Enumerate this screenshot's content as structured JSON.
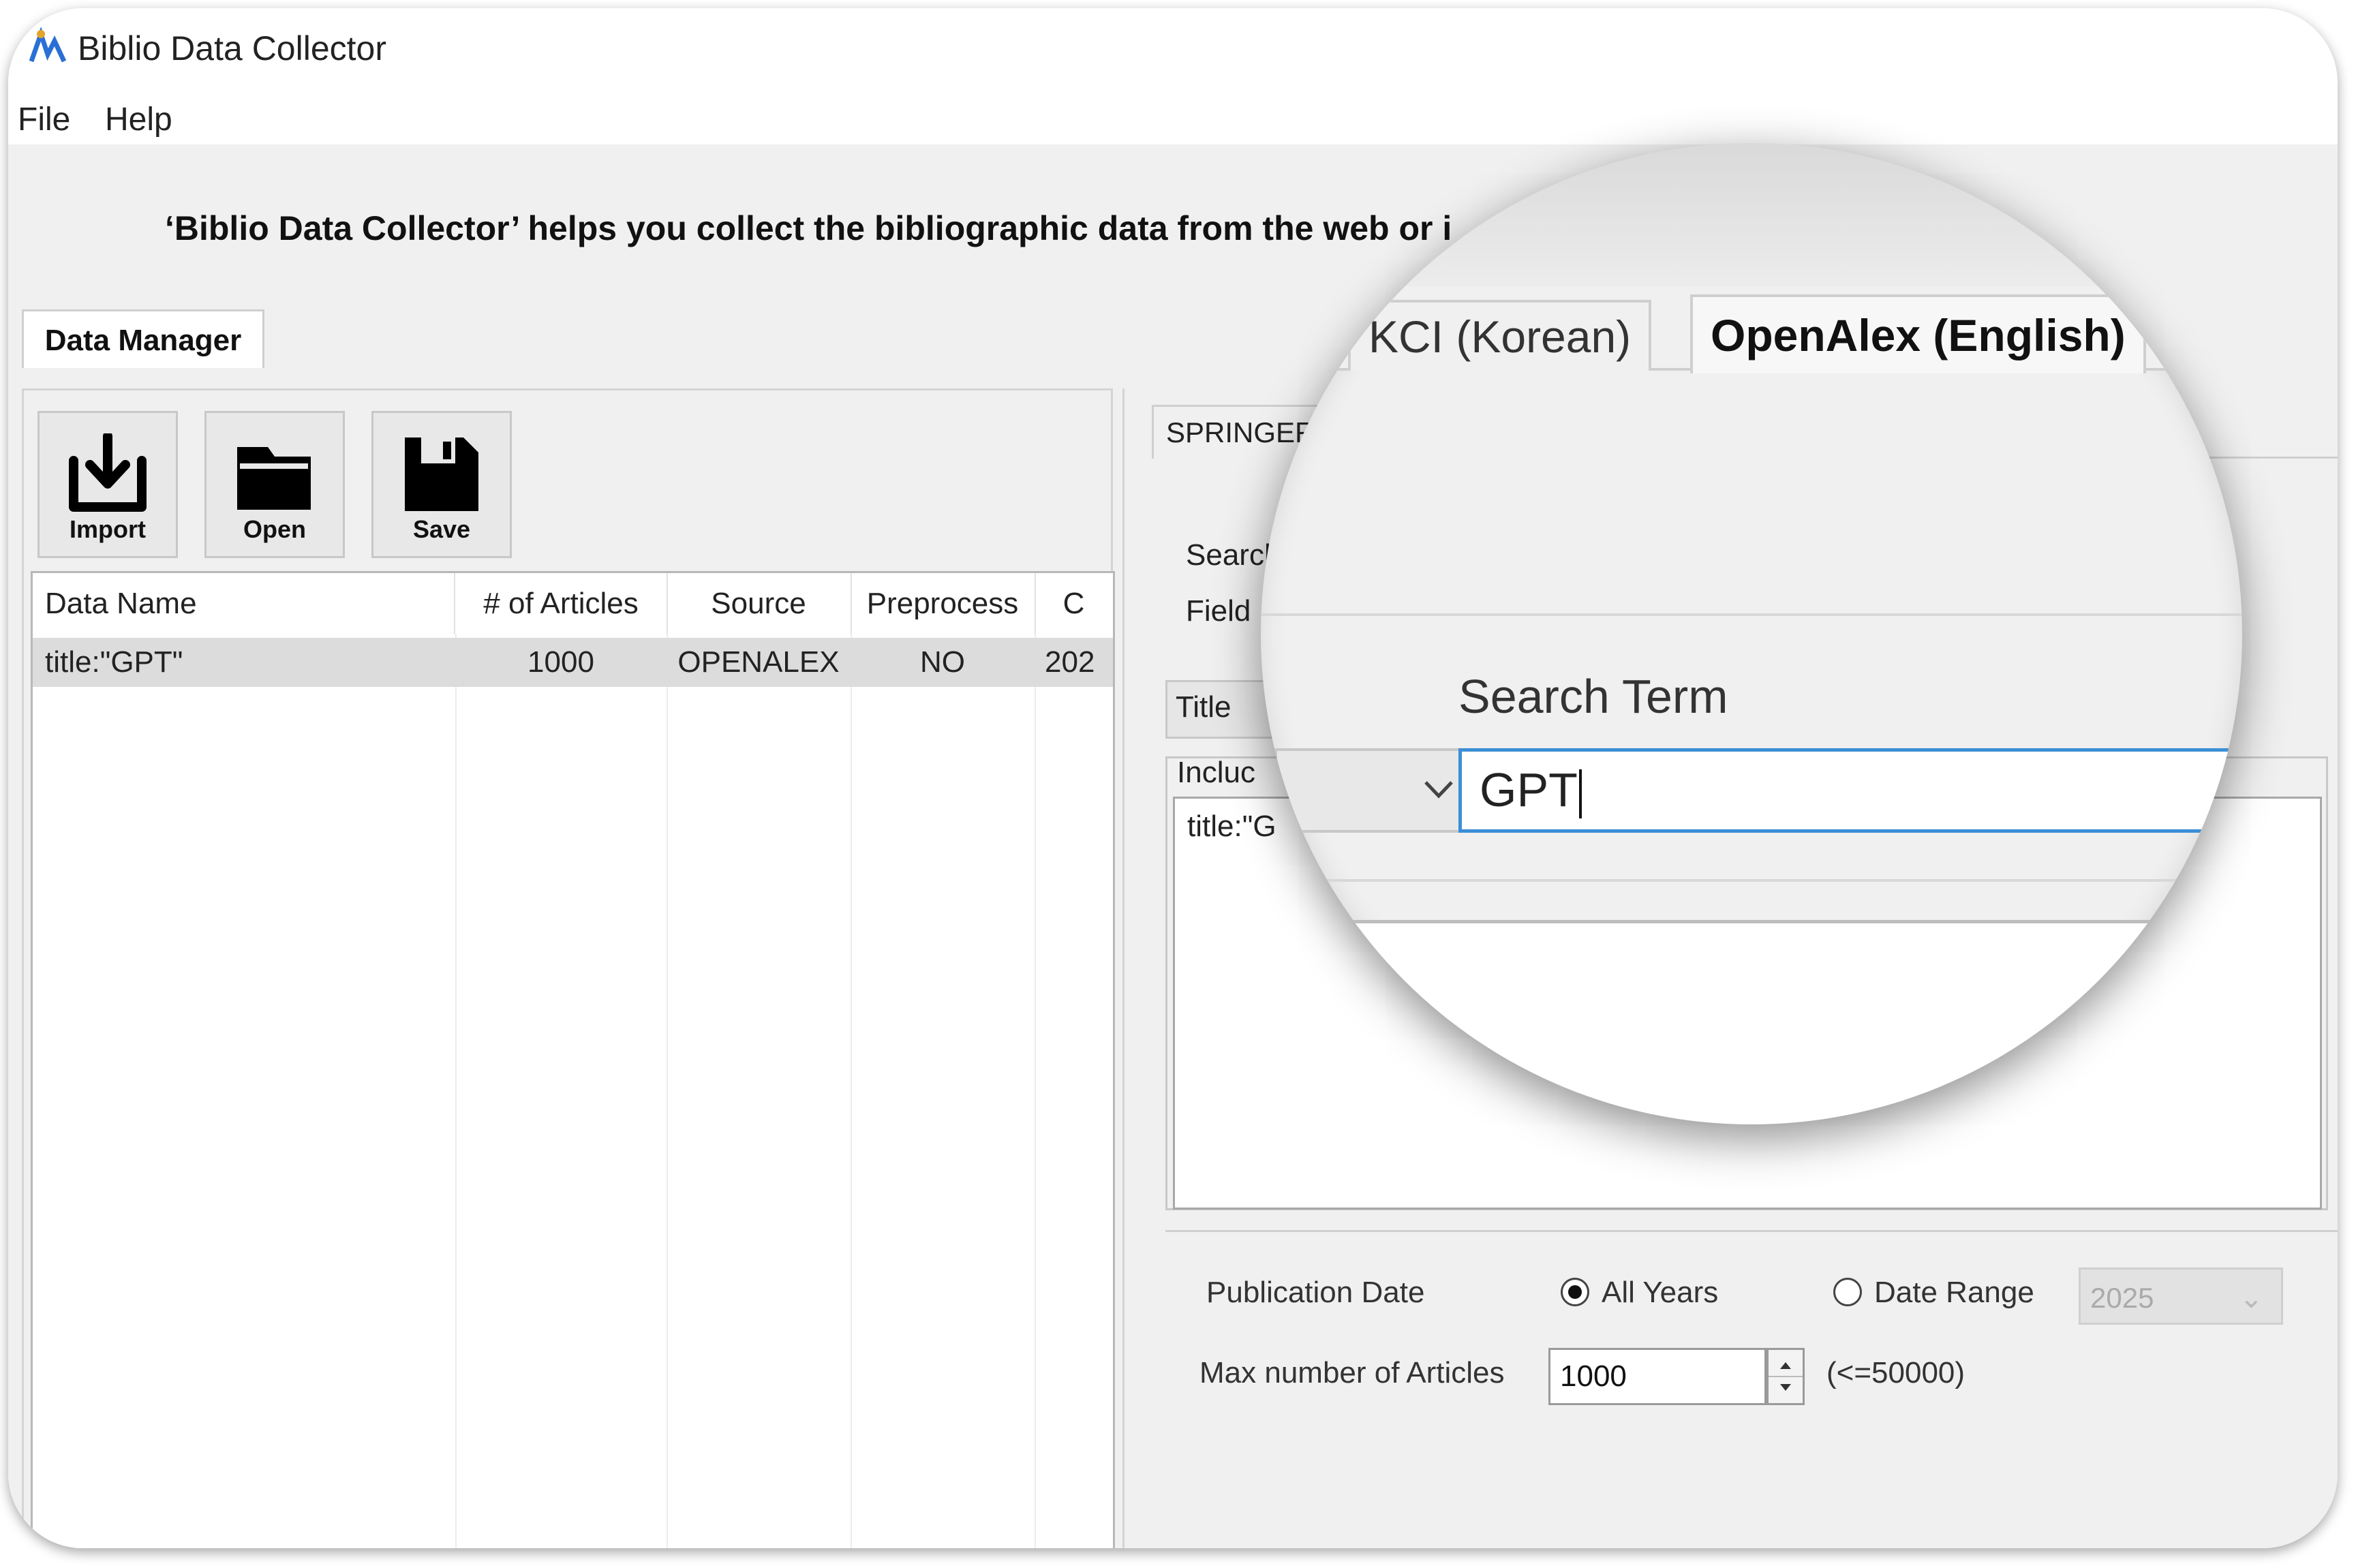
{
  "window": {
    "title": "Biblio Data Collector"
  },
  "menu": {
    "items": [
      "File",
      "Help"
    ]
  },
  "banner": {
    "text": "‘Biblio Data Collector’ helps you collect the bibliographic data from the web or i"
  },
  "main_tabs": {
    "data_manager": "Data Manager"
  },
  "toolbar": {
    "import": "Import",
    "open": "Open",
    "save": "Save"
  },
  "table": {
    "headers": [
      "Data Name",
      "# of Articles",
      "Source",
      "Preprocess",
      "C"
    ],
    "rows": [
      {
        "name": "title:\"GPT\"",
        "articles": "1000",
        "source": "OPENALEX",
        "preprocess": "NO",
        "created": "202"
      }
    ]
  },
  "source_tabs": {
    "springer": "SPRINGER",
    "kci": "KCI (Korean)",
    "openalex": "OpenAlex (English)"
  },
  "search": {
    "section_label": "Search",
    "field_label": "Field",
    "field_value": "Title",
    "term_label": "Search Term",
    "term_value": "GPT",
    "include_label": "Incluc",
    "include_item": "title:\"G"
  },
  "options": {
    "pub_date_label": "Publication Date",
    "all_years": "All Years",
    "date_range": "Date Range",
    "year_value": "2025",
    "max_label": "Max number of Articles",
    "max_value": "1000",
    "max_hint": "(<=50000)"
  }
}
